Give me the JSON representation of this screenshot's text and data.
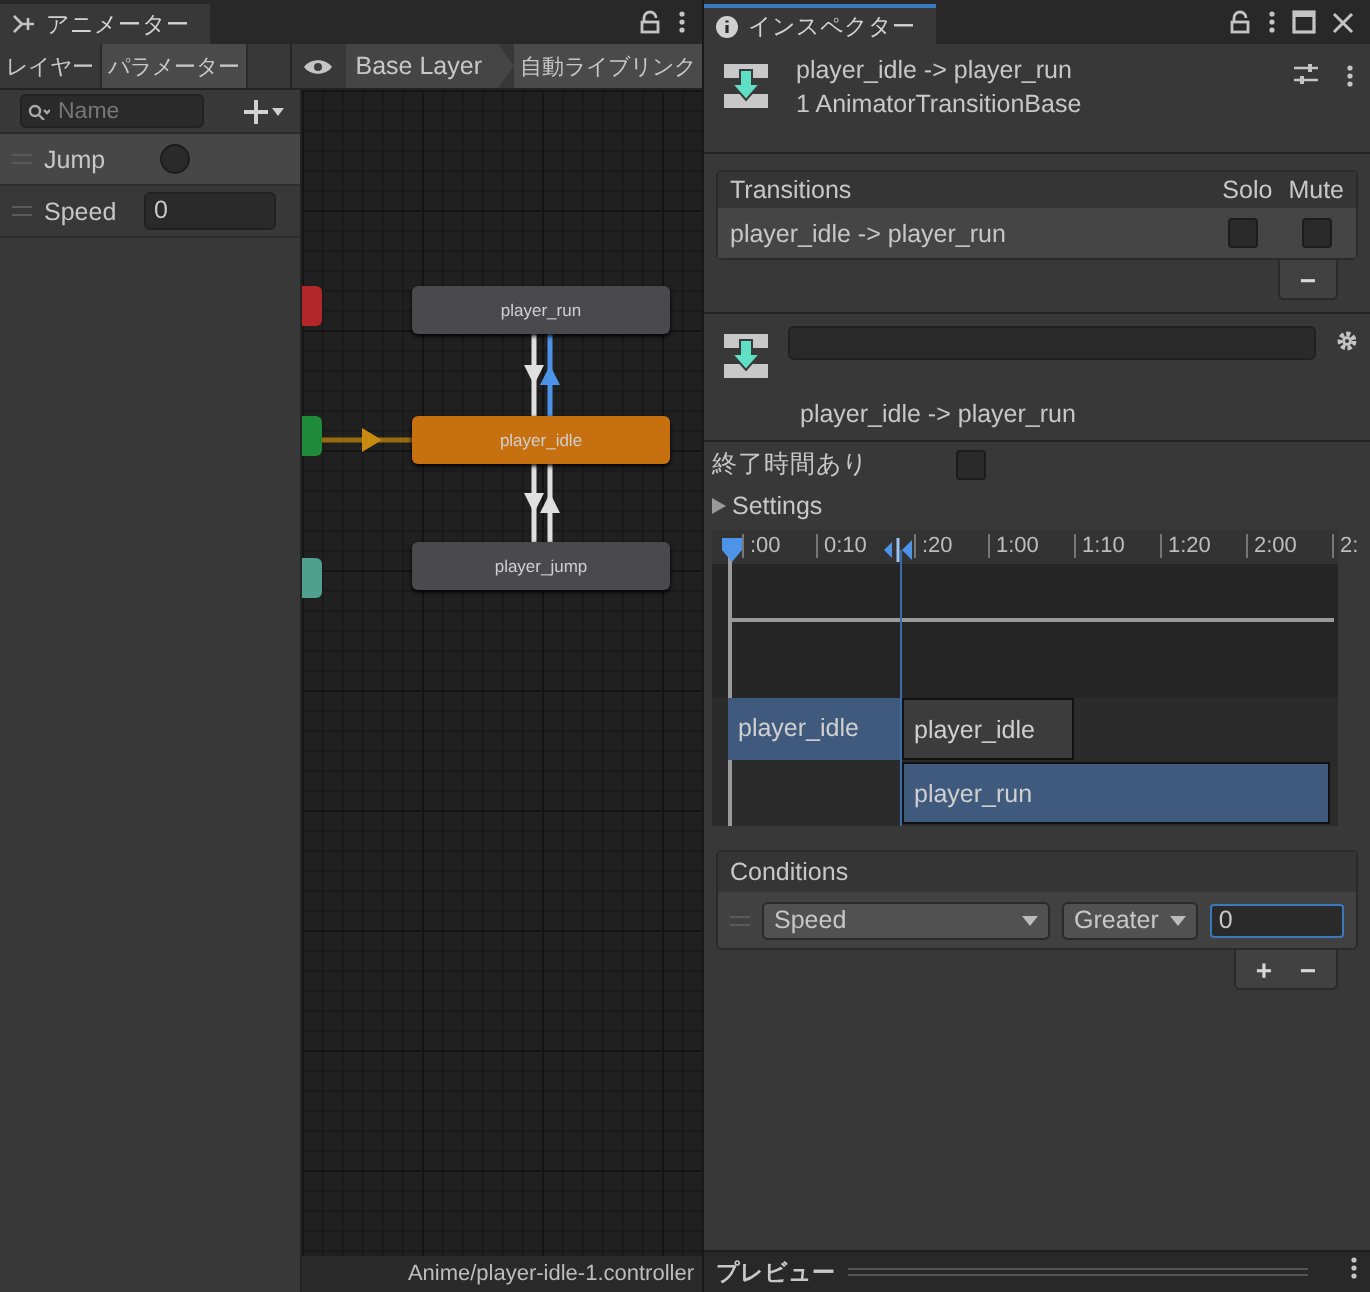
{
  "animator": {
    "tab": "アニメーター",
    "panel_tabs": [
      {
        "label": "レイヤー",
        "selected": false
      },
      {
        "label": "パラメーター",
        "selected": true
      }
    ],
    "breadcrumb": "Base Layer",
    "live_link_button": "自動ライブリンク",
    "search": {
      "placeholder": "Name"
    },
    "parameters": [
      {
        "name": "Jump",
        "kind": "bool",
        "checked": false
      },
      {
        "name": "Speed",
        "kind": "float",
        "value": "0"
      }
    ],
    "graph": {
      "side_nodes": [
        {
          "color": "#b3262a"
        },
        {
          "color": "#1f8a3a"
        },
        {
          "color": "#4fa08c"
        }
      ],
      "states": [
        {
          "name": "player_run",
          "default": false
        },
        {
          "name": "player_idle",
          "default": true
        },
        {
          "name": "player_jump",
          "default": false
        }
      ],
      "transitions": [
        {
          "kind": "down",
          "selected": false
        },
        {
          "kind": "up",
          "selected": true
        },
        {
          "kind": "down",
          "selected": false
        },
        {
          "kind": "up",
          "selected": false
        }
      ]
    },
    "status": "Anime/player-idle-1.controller"
  },
  "inspector": {
    "tab": "インスペクター",
    "title": "player_idle -> player_run",
    "subtitle": "1 AnimatorTransitionBase",
    "transitions_list": {
      "header": "Transitions",
      "columns": [
        "Solo",
        "Mute"
      ],
      "rows": [
        {
          "name": "player_idle -> player_run",
          "solo": false,
          "mute": false
        }
      ],
      "remove_button": "−"
    },
    "transition": {
      "label": "player_idle -> player_run"
    },
    "has_exit_time": {
      "label": "終了時間あり",
      "checked": false
    },
    "settings": {
      "label": "Settings",
      "expanded": false
    },
    "timeline": {
      "ticks": [
        ":00",
        "0:10",
        ":20",
        "1:00",
        "1:10",
        "1:20",
        "2:00",
        "2:"
      ],
      "clips": [
        {
          "label": "player_idle",
          "kind": "source"
        },
        {
          "label": "player_idle",
          "kind": "source-after"
        },
        {
          "label": "player_run",
          "kind": "destination"
        }
      ]
    },
    "conditions": {
      "header": "Conditions",
      "rows": [
        {
          "parameter": "Speed",
          "mode": "Greater",
          "value": "0"
        }
      ],
      "add_button": "+",
      "remove_button": "−"
    },
    "preview": "プレビュー"
  }
}
